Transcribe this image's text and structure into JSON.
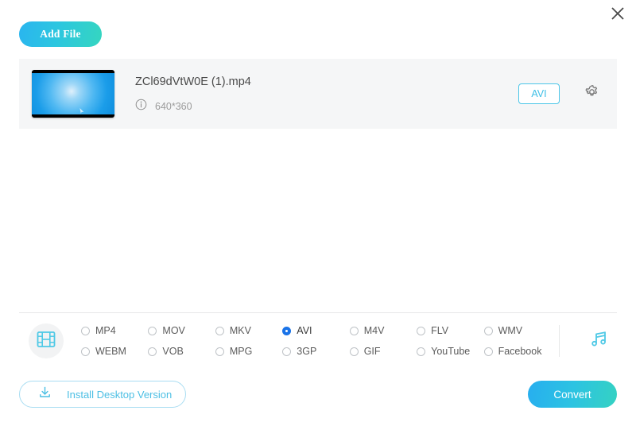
{
  "window": {
    "close_label": "×",
    "close_icon": "close-icon"
  },
  "toolbar": {
    "add_file_label": "Add File",
    "add_file_gradient_from": "#2ab5ef",
    "add_file_gradient_to": "#35d6c0"
  },
  "file_list": [
    {
      "name": "ZCl69dVtW0E (1).mp4",
      "resolution": "640*360",
      "info_icon": "info-icon",
      "output_format": "AVI",
      "settings_icon": "gear-icon",
      "thumbnail": "video-thumbnail"
    }
  ],
  "format_panel": {
    "video_tab_icon": "film-strip-icon",
    "audio_tab_icon": "music-note-icon",
    "video_tab_active": true,
    "accent_color": "#4cc6e8",
    "selected_format": "AVI",
    "formats": [
      {
        "label": "MP4",
        "selected": false
      },
      {
        "label": "MOV",
        "selected": false
      },
      {
        "label": "MKV",
        "selected": false
      },
      {
        "label": "AVI",
        "selected": true
      },
      {
        "label": "M4V",
        "selected": false
      },
      {
        "label": "FLV",
        "selected": false
      },
      {
        "label": "WMV",
        "selected": false
      },
      {
        "label": "WEBM",
        "selected": false
      },
      {
        "label": "VOB",
        "selected": false
      },
      {
        "label": "MPG",
        "selected": false
      },
      {
        "label": "3GP",
        "selected": false
      },
      {
        "label": "GIF",
        "selected": false
      },
      {
        "label": "YouTube",
        "selected": false
      },
      {
        "label": "Facebook",
        "selected": false
      }
    ]
  },
  "footer": {
    "install_label": "Install Desktop Version",
    "install_icon": "download-icon",
    "convert_label": "Convert",
    "convert_gradient_from": "#27aeef",
    "convert_gradient_to": "#35d2c2"
  }
}
